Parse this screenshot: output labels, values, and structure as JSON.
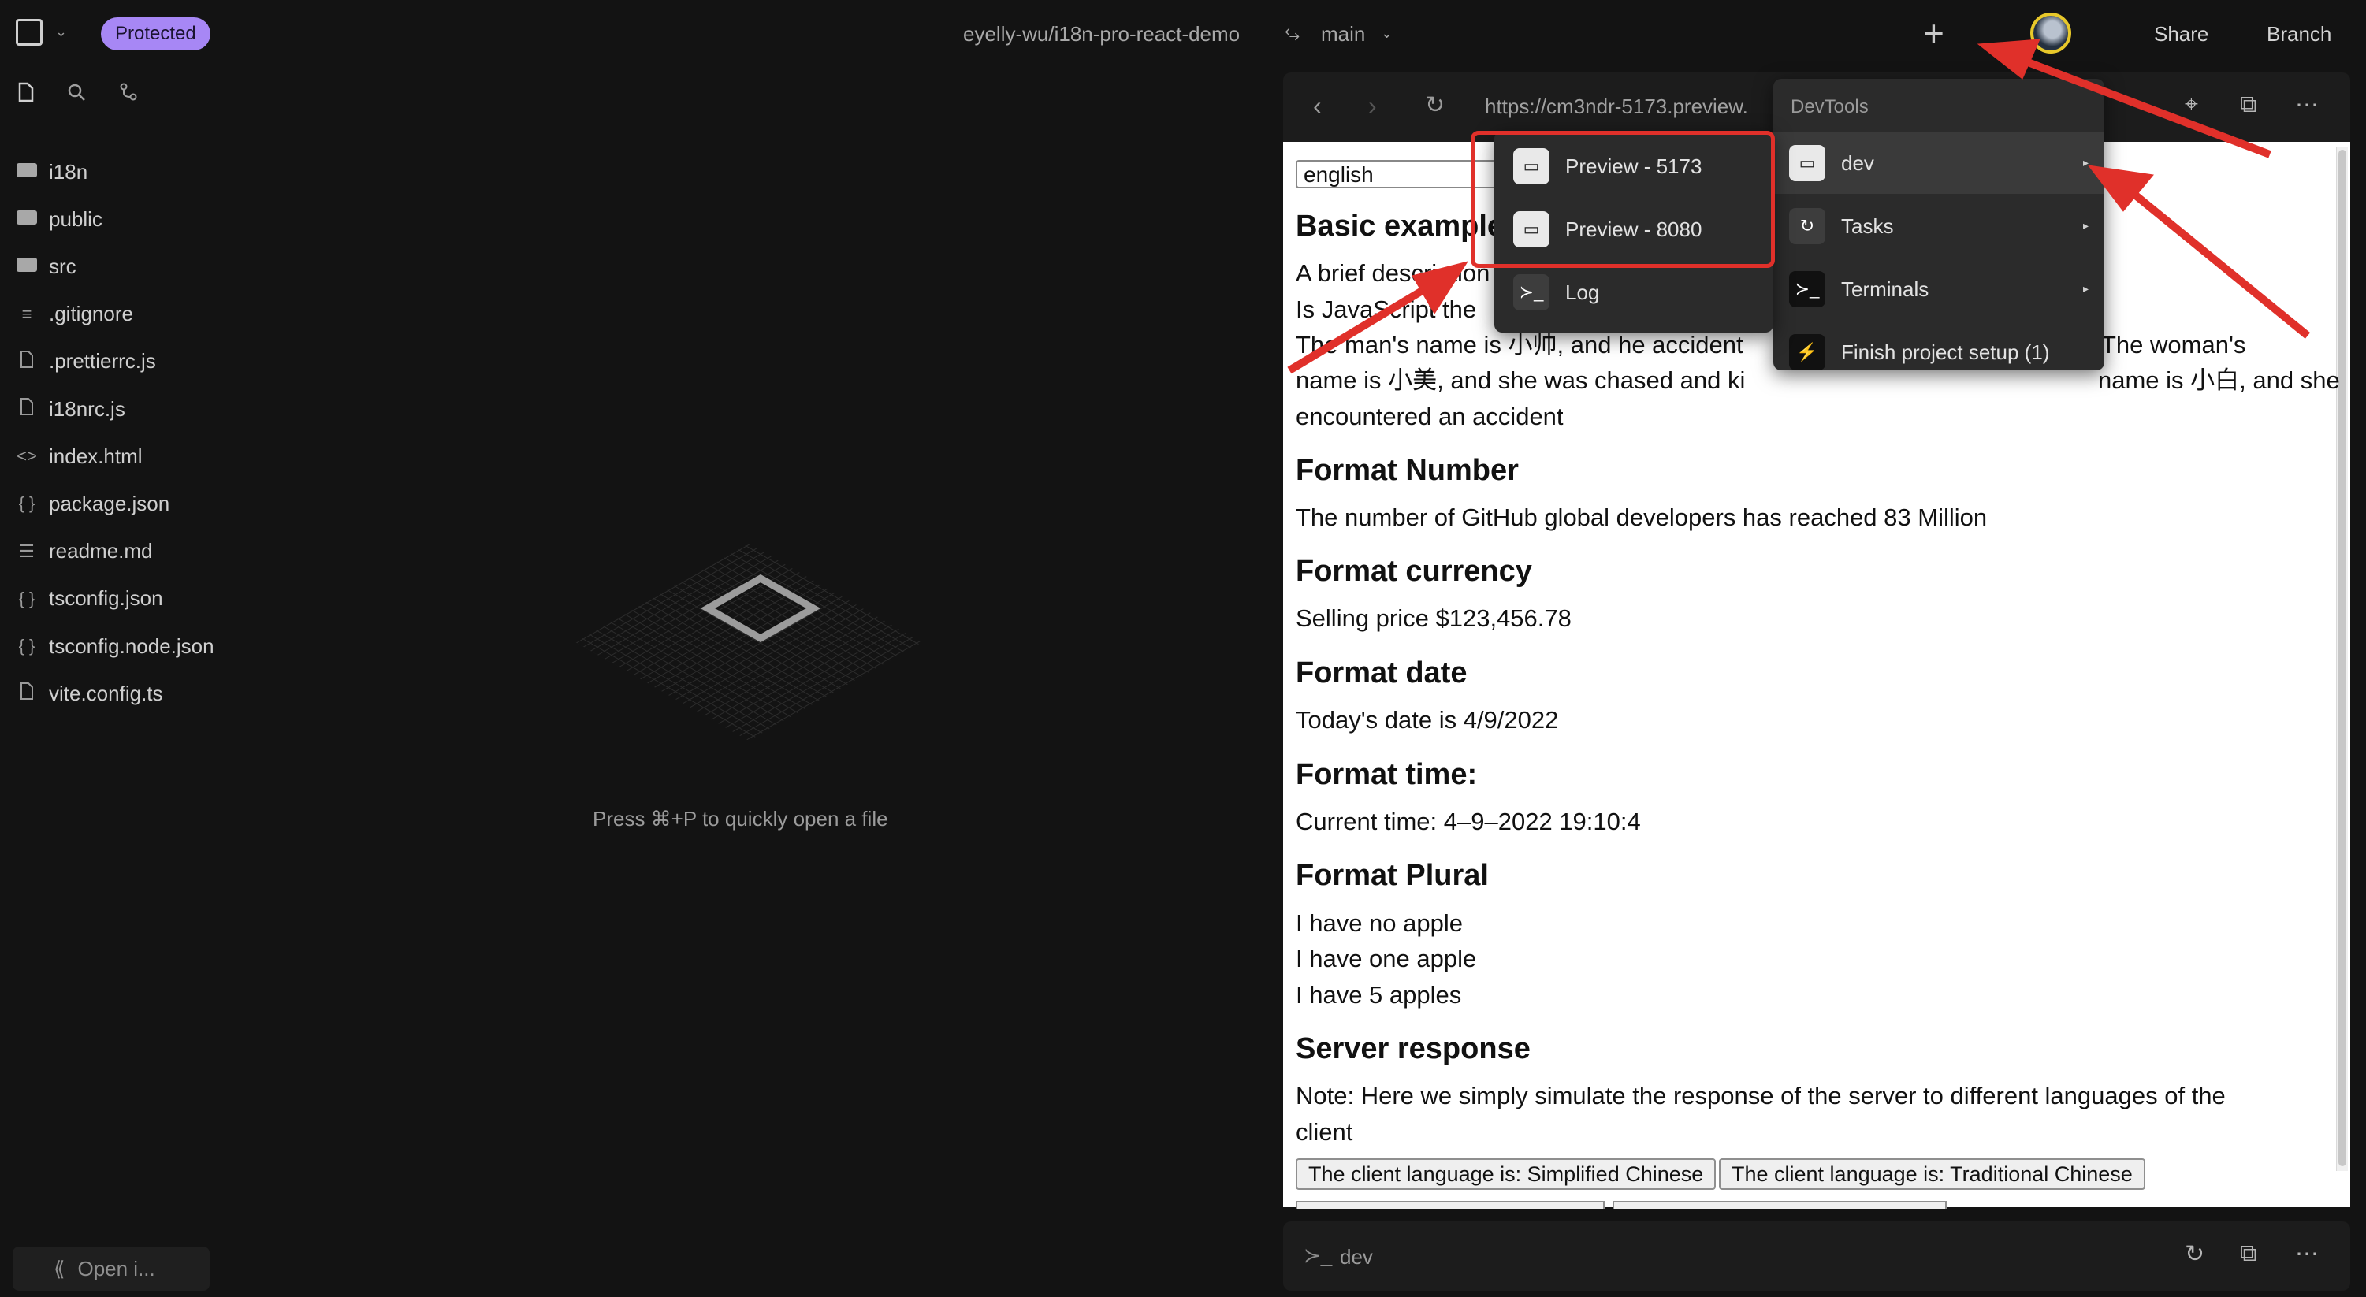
{
  "topbar": {
    "badge": "Protected",
    "repo": "eyelly-wu/i18n-pro-react-demo",
    "branch": "main",
    "share": "Share",
    "branch_button": "Branch"
  },
  "sidebar": {
    "files": [
      {
        "name": "i18n",
        "type": "folder"
      },
      {
        "name": "public",
        "type": "folder"
      },
      {
        "name": "src",
        "type": "folder"
      },
      {
        "name": ".gitignore",
        "type": "lines"
      },
      {
        "name": ".prettierrc.js",
        "type": "file"
      },
      {
        "name": "i18nrc.js",
        "type": "file"
      },
      {
        "name": "index.html",
        "type": "code"
      },
      {
        "name": "package.json",
        "type": "json"
      },
      {
        "name": "readme.md",
        "type": "markdown"
      },
      {
        "name": "tsconfig.json",
        "type": "json"
      },
      {
        "name": "tsconfig.node.json",
        "type": "json"
      },
      {
        "name": "vite.config.ts",
        "type": "file"
      }
    ],
    "open_button": "Open i..."
  },
  "editor": {
    "hint": "Press ⌘+P to quickly open a file"
  },
  "preview": {
    "url": "https://cm3ndr-5173.preview.",
    "language_select": "english",
    "sections": {
      "basic_title": "Basic example",
      "basic_line1": "A brief description",
      "basic_line2": "Is JavaScript the",
      "basic_line3a": "The man's name is 小帅, and he accident",
      "basic_line3b": "The woman's",
      "basic_line4a": "name is 小美, and she was chased and ki",
      "basic_line4b": "name is 小白, and she",
      "basic_line5": "encountered an accident",
      "number_title": "Format Number",
      "number_text": "The number of GitHub global developers has reached 83 Million",
      "currency_title": "Format currency",
      "currency_text": "Selling price $123,456.78",
      "date_title": "Format date",
      "date_text": "Today's date is 4/9/2022",
      "time_title": "Format time:",
      "time_text": "Current time: 4–9–2022 19:10:4",
      "plural_title": "Format Plural",
      "plural_1": "I have no apple",
      "plural_2": "I have one apple",
      "plural_3": "I have 5 apples",
      "server_title": "Server response",
      "server_note_1": "Note: Here we simply simulate the response of the server to different languages of the",
      "server_note_2": "client",
      "button_1": "The client language is: Simplified Chinese",
      "button_2": "The client language is: Traditional Chinese"
    }
  },
  "terminal_bar": {
    "label": "dev"
  },
  "devtools_menu": {
    "title": "DevTools",
    "items": [
      "dev",
      "Tasks",
      "Terminals",
      "Finish project setup (1)"
    ]
  },
  "dev_submenu": {
    "items": [
      "Preview - 5173",
      "Preview - 8080",
      "Log"
    ]
  },
  "colors": {
    "background": "#131313",
    "badge": "#a787f5",
    "highlight": "#e0302a",
    "avatar_ring": "#e8c82a"
  }
}
